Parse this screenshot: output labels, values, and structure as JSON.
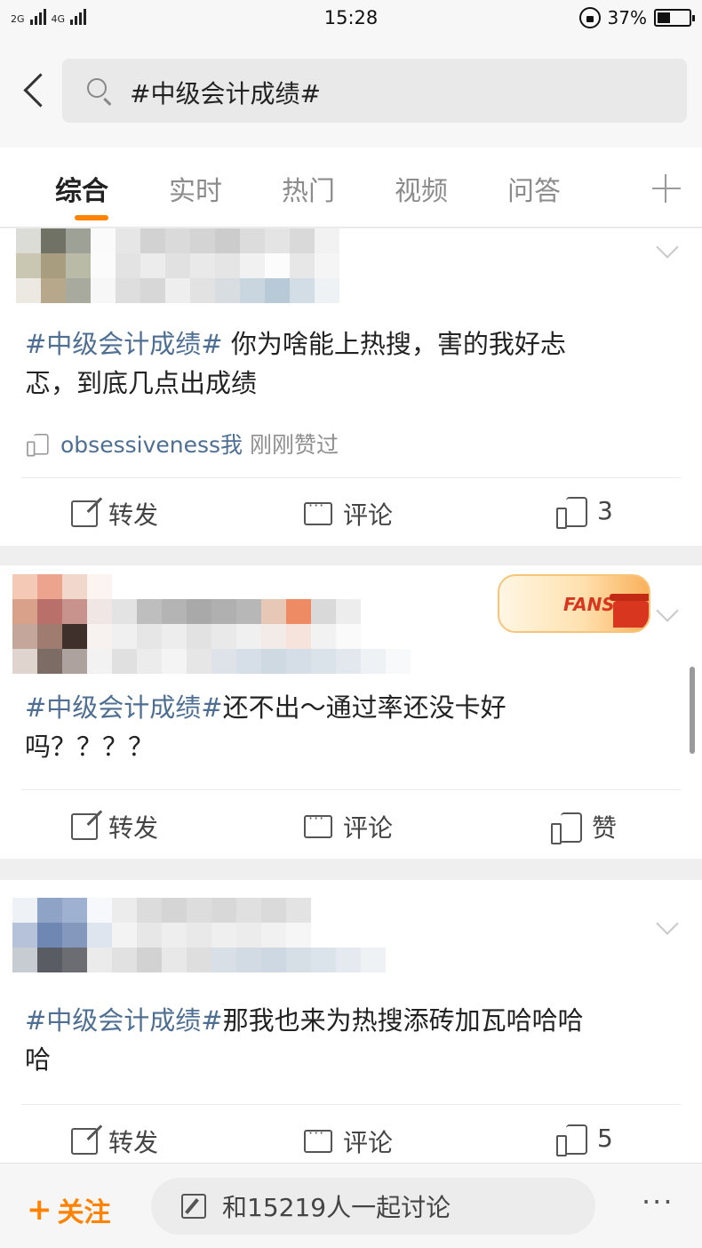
{
  "status_bar": {
    "signal_1": "2G",
    "signal_2": "4G",
    "time": "15:28",
    "battery": "37%",
    "battery_level": 0.37
  },
  "search": {
    "query": "#中级会计成绩#"
  },
  "tabs": [
    {
      "label": "综合",
      "active": true
    },
    {
      "label": "实时",
      "active": false
    },
    {
      "label": "热门",
      "active": false
    },
    {
      "label": "视频",
      "active": false
    },
    {
      "label": "问答",
      "active": false
    }
  ],
  "posts": [
    {
      "hashtag": "#中级会计成绩#",
      "text_line1": " 你为啥能上热搜，害的我好忐",
      "text_line2": "忑，到底几点出成绩",
      "liked_by_user": "obsessiveness我",
      "liked_suffix": "刚刚赞过",
      "repost_label": "转发",
      "comment_label": "评论",
      "like_label": "3"
    },
    {
      "hashtag": "#中级会计成绩#",
      "text_line1": "还不出～通过率还没卡好",
      "text_line2": "吗？？？？",
      "badge_text": "FANS",
      "repost_label": "转发",
      "comment_label": "评论",
      "like_label": "赞"
    },
    {
      "hashtag": "#中级会计成绩#",
      "text_line1": "那我也来为热搜添砖加瓦哈哈哈",
      "text_line2": "哈",
      "repost_label": "转发",
      "comment_label": "评论",
      "like_label": "5"
    }
  ],
  "bottom_bar": {
    "follow_plus": "+",
    "follow_label": "关注",
    "discuss_label": "和15219人一起讨论",
    "more_label": "···"
  },
  "colors": {
    "accent": "#ff8200",
    "hashtag": "#4e6f93"
  }
}
